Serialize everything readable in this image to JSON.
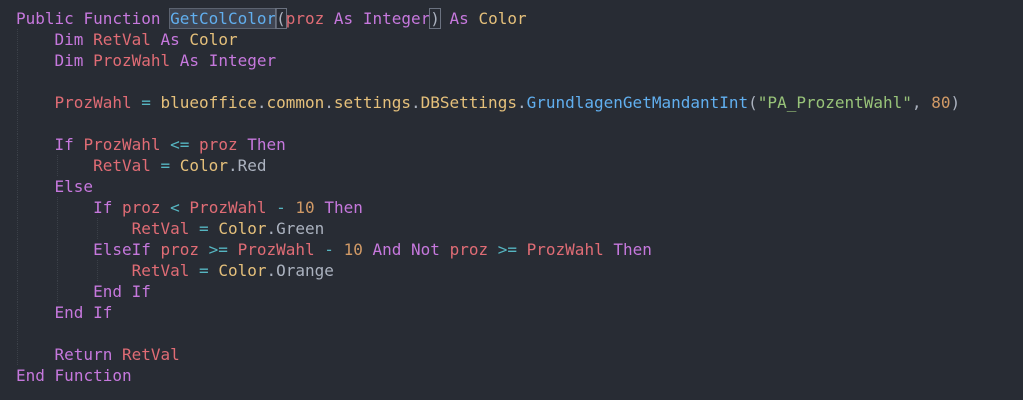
{
  "editor": {
    "theme_colors": {
      "background": "#282c34",
      "keyword": "#c678dd",
      "type": "#e5c07b",
      "identifier": "#e06c75",
      "function": "#61afef",
      "string": "#98c379",
      "number": "#d19a66",
      "operator": "#56b6c2",
      "plain": "#abb2bf"
    },
    "lines": [
      {
        "indent": "",
        "tokens": [
          {
            "t": "Public",
            "c": "kw"
          },
          {
            "t": " ",
            "c": "pl"
          },
          {
            "t": "Function",
            "c": "kw"
          },
          {
            "t": " ",
            "c": "pl"
          },
          {
            "t": "GetColColor",
            "c": "fnhl"
          },
          {
            "t": "(",
            "c": "bracket"
          },
          {
            "t": "proz",
            "c": "id"
          },
          {
            "t": " ",
            "c": "pl"
          },
          {
            "t": "As",
            "c": "kw"
          },
          {
            "t": " ",
            "c": "pl"
          },
          {
            "t": "Integer",
            "c": "kw"
          },
          {
            "t": ")",
            "c": "bracket"
          },
          {
            "t": " ",
            "c": "pl"
          },
          {
            "t": "As",
            "c": "kw"
          },
          {
            "t": " ",
            "c": "pl"
          },
          {
            "t": "Color",
            "c": "ty"
          }
        ]
      },
      {
        "indent": "    ",
        "tokens": [
          {
            "t": "Dim",
            "c": "kw"
          },
          {
            "t": " ",
            "c": "pl"
          },
          {
            "t": "RetVal",
            "c": "id"
          },
          {
            "t": " ",
            "c": "pl"
          },
          {
            "t": "As",
            "c": "kw"
          },
          {
            "t": " ",
            "c": "pl"
          },
          {
            "t": "Color",
            "c": "ty"
          }
        ]
      },
      {
        "indent": "    ",
        "tokens": [
          {
            "t": "Dim",
            "c": "kw"
          },
          {
            "t": " ",
            "c": "pl"
          },
          {
            "t": "ProzWahl",
            "c": "id"
          },
          {
            "t": " ",
            "c": "pl"
          },
          {
            "t": "As",
            "c": "kw"
          },
          {
            "t": " ",
            "c": "pl"
          },
          {
            "t": "Integer",
            "c": "kw"
          }
        ]
      },
      {
        "indent": "",
        "tokens": []
      },
      {
        "indent": "    ",
        "tokens": [
          {
            "t": "ProzWahl",
            "c": "id"
          },
          {
            "t": " ",
            "c": "pl"
          },
          {
            "t": "=",
            "c": "op"
          },
          {
            "t": " ",
            "c": "pl"
          },
          {
            "t": "blueoffice",
            "c": "ns"
          },
          {
            "t": ".",
            "c": "pl"
          },
          {
            "t": "common",
            "c": "ns"
          },
          {
            "t": ".",
            "c": "pl"
          },
          {
            "t": "settings",
            "c": "ns"
          },
          {
            "t": ".",
            "c": "pl"
          },
          {
            "t": "DBSettings",
            "c": "ns"
          },
          {
            "t": ".",
            "c": "pl"
          },
          {
            "t": "GrundlagenGetMandantInt",
            "c": "fn"
          },
          {
            "t": "(",
            "c": "pl"
          },
          {
            "t": "\"PA_ProzentWahl\"",
            "c": "st"
          },
          {
            "t": ", ",
            "c": "pl"
          },
          {
            "t": "80",
            "c": "nu"
          },
          {
            "t": ")",
            "c": "pl"
          }
        ]
      },
      {
        "indent": "",
        "tokens": []
      },
      {
        "indent": "    ",
        "tokens": [
          {
            "t": "If",
            "c": "kw"
          },
          {
            "t": " ",
            "c": "pl"
          },
          {
            "t": "ProzWahl",
            "c": "id"
          },
          {
            "t": " ",
            "c": "pl"
          },
          {
            "t": "<=",
            "c": "op"
          },
          {
            "t": " ",
            "c": "pl"
          },
          {
            "t": "proz",
            "c": "id"
          },
          {
            "t": " ",
            "c": "pl"
          },
          {
            "t": "Then",
            "c": "kw"
          }
        ]
      },
      {
        "indent": "        ",
        "tokens": [
          {
            "t": "RetVal",
            "c": "id"
          },
          {
            "t": " ",
            "c": "pl"
          },
          {
            "t": "=",
            "c": "op"
          },
          {
            "t": " ",
            "c": "pl"
          },
          {
            "t": "Color",
            "c": "ty"
          },
          {
            "t": ".",
            "c": "pl"
          },
          {
            "t": "Red",
            "c": "pl"
          }
        ]
      },
      {
        "indent": "    ",
        "tokens": [
          {
            "t": "Else",
            "c": "kw"
          }
        ]
      },
      {
        "indent": "        ",
        "tokens": [
          {
            "t": "If",
            "c": "kw"
          },
          {
            "t": " ",
            "c": "pl"
          },
          {
            "t": "proz",
            "c": "id"
          },
          {
            "t": " ",
            "c": "pl"
          },
          {
            "t": "<",
            "c": "op"
          },
          {
            "t": " ",
            "c": "pl"
          },
          {
            "t": "ProzWahl",
            "c": "id"
          },
          {
            "t": " ",
            "c": "pl"
          },
          {
            "t": "-",
            "c": "op"
          },
          {
            "t": " ",
            "c": "pl"
          },
          {
            "t": "10",
            "c": "nu"
          },
          {
            "t": " ",
            "c": "pl"
          },
          {
            "t": "Then",
            "c": "kw"
          }
        ]
      },
      {
        "indent": "            ",
        "tokens": [
          {
            "t": "RetVal",
            "c": "id"
          },
          {
            "t": " ",
            "c": "pl"
          },
          {
            "t": "=",
            "c": "op"
          },
          {
            "t": " ",
            "c": "pl"
          },
          {
            "t": "Color",
            "c": "ty"
          },
          {
            "t": ".",
            "c": "pl"
          },
          {
            "t": "Green",
            "c": "pl"
          }
        ]
      },
      {
        "indent": "        ",
        "tokens": [
          {
            "t": "ElseIf",
            "c": "kw"
          },
          {
            "t": " ",
            "c": "pl"
          },
          {
            "t": "proz",
            "c": "id"
          },
          {
            "t": " ",
            "c": "pl"
          },
          {
            "t": ">=",
            "c": "op"
          },
          {
            "t": " ",
            "c": "pl"
          },
          {
            "t": "ProzWahl",
            "c": "id"
          },
          {
            "t": " ",
            "c": "pl"
          },
          {
            "t": "-",
            "c": "op"
          },
          {
            "t": " ",
            "c": "pl"
          },
          {
            "t": "10",
            "c": "nu"
          },
          {
            "t": " ",
            "c": "pl"
          },
          {
            "t": "And",
            "c": "kw"
          },
          {
            "t": " ",
            "c": "pl"
          },
          {
            "t": "Not",
            "c": "kw"
          },
          {
            "t": " ",
            "c": "pl"
          },
          {
            "t": "proz",
            "c": "id"
          },
          {
            "t": " ",
            "c": "pl"
          },
          {
            "t": ">=",
            "c": "op"
          },
          {
            "t": " ",
            "c": "pl"
          },
          {
            "t": "ProzWahl",
            "c": "id"
          },
          {
            "t": " ",
            "c": "pl"
          },
          {
            "t": "Then",
            "c": "kw"
          }
        ]
      },
      {
        "indent": "            ",
        "tokens": [
          {
            "t": "RetVal",
            "c": "id"
          },
          {
            "t": " ",
            "c": "pl"
          },
          {
            "t": "=",
            "c": "op"
          },
          {
            "t": " ",
            "c": "pl"
          },
          {
            "t": "Color",
            "c": "ty"
          },
          {
            "t": ".",
            "c": "pl"
          },
          {
            "t": "Orange",
            "c": "pl"
          }
        ]
      },
      {
        "indent": "        ",
        "tokens": [
          {
            "t": "End",
            "c": "kw"
          },
          {
            "t": " ",
            "c": "pl"
          },
          {
            "t": "If",
            "c": "kw"
          }
        ]
      },
      {
        "indent": "    ",
        "tokens": [
          {
            "t": "End",
            "c": "kw"
          },
          {
            "t": " ",
            "c": "pl"
          },
          {
            "t": "If",
            "c": "kw"
          }
        ]
      },
      {
        "indent": "",
        "tokens": []
      },
      {
        "indent": "    ",
        "tokens": [
          {
            "t": "Return",
            "c": "kw"
          },
          {
            "t": " ",
            "c": "pl"
          },
          {
            "t": "RetVal",
            "c": "id"
          }
        ]
      },
      {
        "indent": "",
        "tokens": [
          {
            "t": "End",
            "c": "kw"
          },
          {
            "t": " ",
            "c": "pl"
          },
          {
            "t": "Function",
            "c": "kw"
          }
        ]
      }
    ]
  }
}
